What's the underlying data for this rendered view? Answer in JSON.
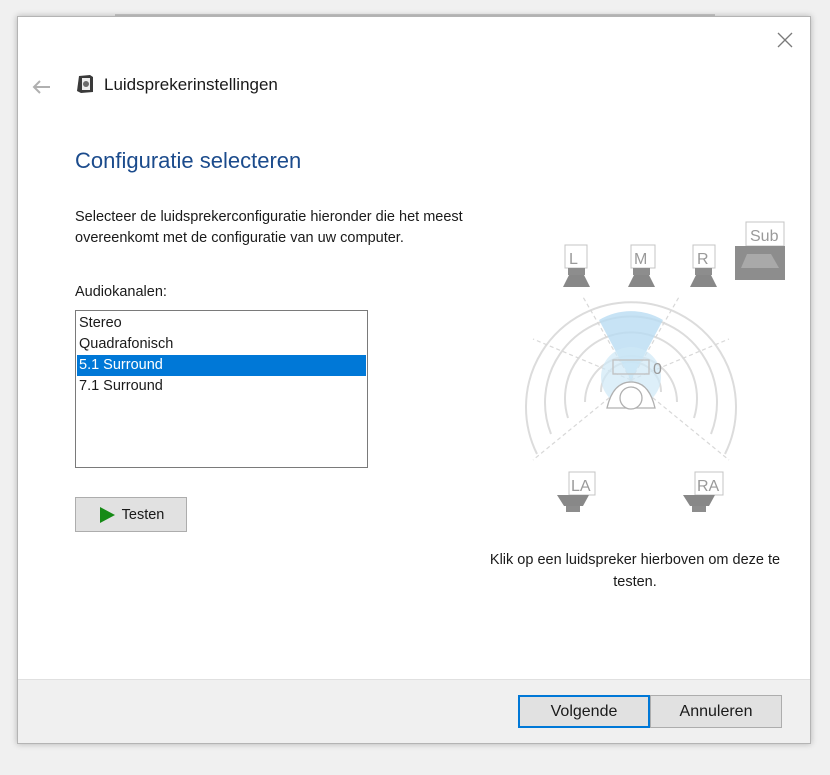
{
  "window": {
    "title": "Luidsprekerinstellingen"
  },
  "page": {
    "heading": "Configuratie selecteren",
    "description": "Selecteer de luidsprekerconfiguratie hieronder die het meest overeenkomt met de configuratie van uw computer.",
    "list_label": "Audiokanalen:",
    "channels": [
      "Stereo",
      "Quadrafonisch",
      "5.1 Surround",
      "7.1 Surround"
    ],
    "selected_channel": "5.1 Surround",
    "test_label": "Testen",
    "hint": "Klik op een luidspreker hierboven om deze te testen."
  },
  "speakers": {
    "left": "L",
    "center": "M",
    "right": "R",
    "sub": "Sub",
    "rear_left": "LA",
    "rear_right": "RA"
  },
  "footer": {
    "next_label": "Volgende",
    "cancel_label": "Annuleren"
  },
  "colors": {
    "heading": "#1b4b8c",
    "selection": "#0078d7",
    "play_icon": "#168a16"
  },
  "icons": {
    "close": "close-icon",
    "back": "back-arrow-icon",
    "app": "speaker-app-icon",
    "play": "play-icon"
  }
}
